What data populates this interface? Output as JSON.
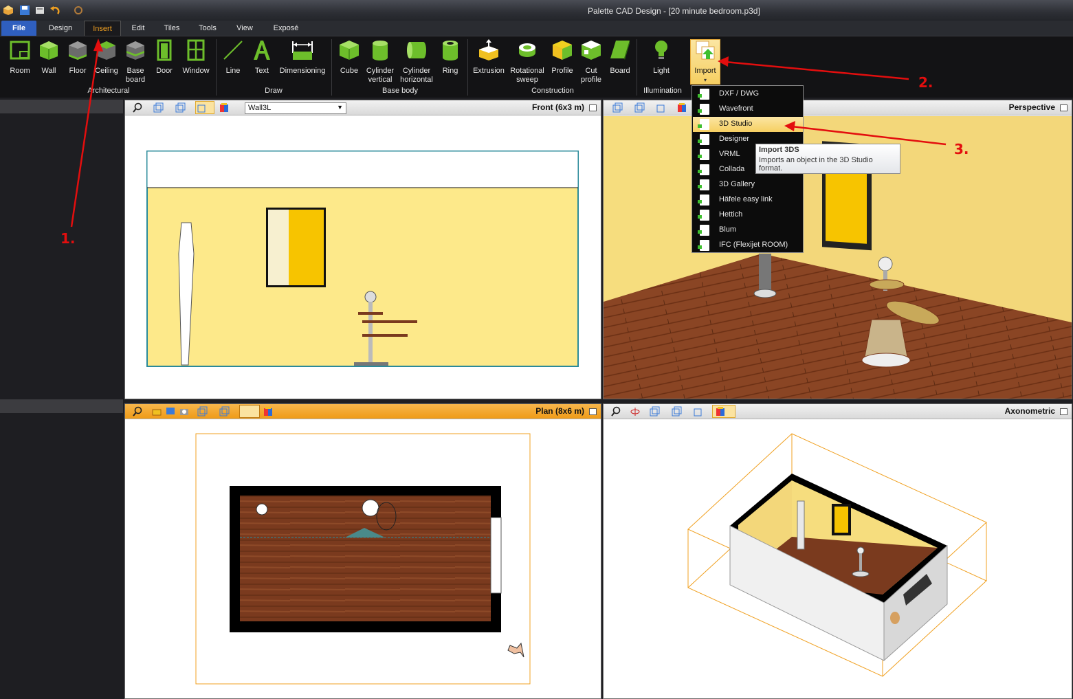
{
  "window": {
    "title": "Palette CAD Design - [20 minute bedroom.p3d]"
  },
  "menu": {
    "tabs": [
      {
        "label": "File"
      },
      {
        "label": "Design"
      },
      {
        "label": "Insert"
      },
      {
        "label": "Edit"
      },
      {
        "label": "Tiles"
      },
      {
        "label": "Tools"
      },
      {
        "label": "View"
      },
      {
        "label": "Exposé"
      }
    ]
  },
  "ribbon": {
    "groups": {
      "architectural": "Architectural",
      "draw": "Draw",
      "base_body": "Base body",
      "construction": "Construction",
      "illumination": "Illumination"
    },
    "buttons": {
      "room": "Room",
      "wall": "Wall",
      "floor": "Floor",
      "ceiling": "Ceiling",
      "baseboard_1": "Base",
      "baseboard_2": "board",
      "door": "Door",
      "window": "Window",
      "line": "Line",
      "text": "Text",
      "dimensioning": "Dimensioning",
      "cube": "Cube",
      "cyl_v_1": "Cylinder",
      "cyl_v_2": "vertical",
      "cyl_h_1": "Cylinder",
      "cyl_h_2": "horizontal",
      "ring": "Ring",
      "extrusion": "Extrusion",
      "rot_1": "Rotational",
      "rot_2": "sweep",
      "profile": "Profile",
      "cut_1": "Cut",
      "cut_2": "profile",
      "board": "Board",
      "light": "Light",
      "import": "Import"
    }
  },
  "import_menu": {
    "items": [
      {
        "label": "DXF / DWG"
      },
      {
        "label": "Wavefront"
      },
      {
        "label": "3D Studio"
      },
      {
        "label": "Designer"
      },
      {
        "label": "VRML"
      },
      {
        "label": "Collada"
      },
      {
        "label": "3D Gallery"
      },
      {
        "label": "Häfele easy link"
      },
      {
        "label": "Hettich"
      },
      {
        "label": "Blum"
      },
      {
        "label": "IFC (Flexijet ROOM)"
      }
    ],
    "highlighted": "3D Studio"
  },
  "tooltip": {
    "title": "Import 3DS",
    "description": "Imports an object in the 3D Studio format."
  },
  "viewports": {
    "front": {
      "title": "Front  (6x3 m)",
      "combo": "Wall3L"
    },
    "perspective": {
      "title": "Perspective"
    },
    "plan": {
      "title": "Plan  (8x6 m)"
    },
    "axonometric": {
      "title": "Axonometric"
    }
  },
  "annotations": {
    "step1": "1.",
    "step2": "2.",
    "step3": "3."
  },
  "colors": {
    "accent": "#f0a020",
    "wall_yellow": "#fde98a",
    "floor_wood": "#7a3a1e",
    "annotation_red": "#e30e0e"
  }
}
